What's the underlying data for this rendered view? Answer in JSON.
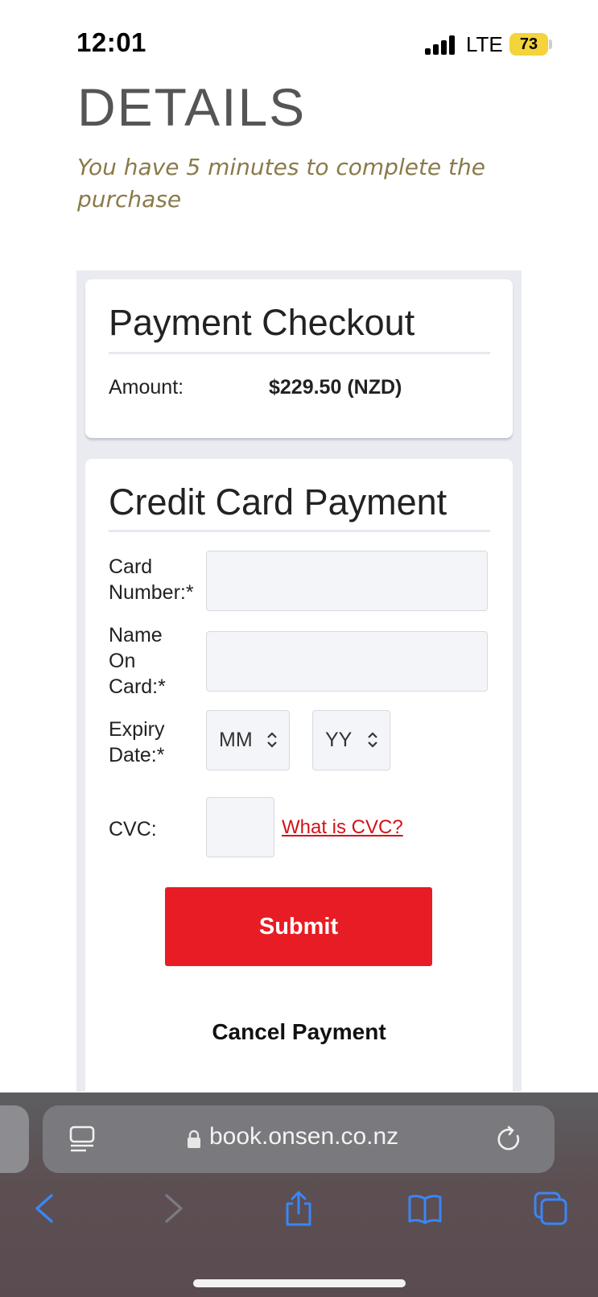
{
  "status_bar": {
    "time": "12:01",
    "network": "LTE",
    "battery": "73"
  },
  "page": {
    "heading": "DETAILS",
    "timer_note": "You have 5 minutes to complete the purchase"
  },
  "checkout": {
    "title": "Payment Checkout",
    "amount_label": "Amount:",
    "amount_value": "$229.50 (NZD)"
  },
  "payment": {
    "title": "Credit Card Payment",
    "card_number_label": "Card Number:*",
    "name_on_card_label": "Name On Card:*",
    "expiry_label": "Expiry Date:*",
    "month_select": "MM",
    "year_select": "YY",
    "cvc_label": "CVC:",
    "cvc_help_link": "What is CVC?",
    "submit_label": "Submit",
    "cancel_label": "Cancel Payment"
  },
  "browser": {
    "url": "book.onsen.co.nz",
    "icons": [
      "reader-icon",
      "lock-icon",
      "reload-icon",
      "back-icon",
      "forward-icon",
      "share-icon",
      "bookmarks-icon",
      "tabs-icon"
    ]
  },
  "colors": {
    "accent_red": "#e81c24",
    "link_red": "#d31217",
    "timer_text": "#8a7a4a",
    "battery_yellow": "#f4d33b",
    "ios_blue": "#3a86f5"
  }
}
